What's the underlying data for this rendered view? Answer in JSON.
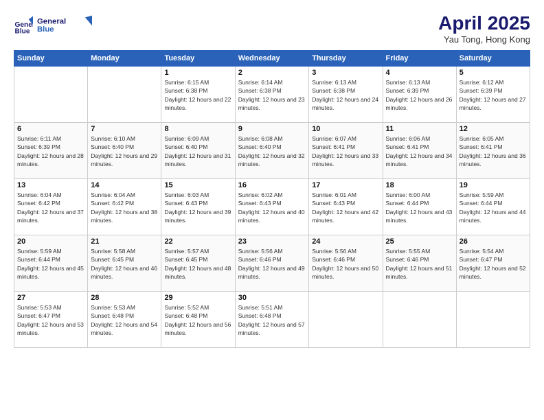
{
  "logo": {
    "line1": "General",
    "line2": "Blue"
  },
  "title": "April 2025",
  "subtitle": "Yau Tong, Hong Kong",
  "weekdays": [
    "Sunday",
    "Monday",
    "Tuesday",
    "Wednesday",
    "Thursday",
    "Friday",
    "Saturday"
  ],
  "weeks": [
    [
      {
        "day": "",
        "info": ""
      },
      {
        "day": "",
        "info": ""
      },
      {
        "day": "1",
        "info": "Sunrise: 6:15 AM\nSunset: 6:38 PM\nDaylight: 12 hours and 22 minutes."
      },
      {
        "day": "2",
        "info": "Sunrise: 6:14 AM\nSunset: 6:38 PM\nDaylight: 12 hours and 23 minutes."
      },
      {
        "day": "3",
        "info": "Sunrise: 6:13 AM\nSunset: 6:38 PM\nDaylight: 12 hours and 24 minutes."
      },
      {
        "day": "4",
        "info": "Sunrise: 6:13 AM\nSunset: 6:39 PM\nDaylight: 12 hours and 26 minutes."
      },
      {
        "day": "5",
        "info": "Sunrise: 6:12 AM\nSunset: 6:39 PM\nDaylight: 12 hours and 27 minutes."
      }
    ],
    [
      {
        "day": "6",
        "info": "Sunrise: 6:11 AM\nSunset: 6:39 PM\nDaylight: 12 hours and 28 minutes."
      },
      {
        "day": "7",
        "info": "Sunrise: 6:10 AM\nSunset: 6:40 PM\nDaylight: 12 hours and 29 minutes."
      },
      {
        "day": "8",
        "info": "Sunrise: 6:09 AM\nSunset: 6:40 PM\nDaylight: 12 hours and 31 minutes."
      },
      {
        "day": "9",
        "info": "Sunrise: 6:08 AM\nSunset: 6:40 PM\nDaylight: 12 hours and 32 minutes."
      },
      {
        "day": "10",
        "info": "Sunrise: 6:07 AM\nSunset: 6:41 PM\nDaylight: 12 hours and 33 minutes."
      },
      {
        "day": "11",
        "info": "Sunrise: 6:06 AM\nSunset: 6:41 PM\nDaylight: 12 hours and 34 minutes."
      },
      {
        "day": "12",
        "info": "Sunrise: 6:05 AM\nSunset: 6:41 PM\nDaylight: 12 hours and 36 minutes."
      }
    ],
    [
      {
        "day": "13",
        "info": "Sunrise: 6:04 AM\nSunset: 6:42 PM\nDaylight: 12 hours and 37 minutes."
      },
      {
        "day": "14",
        "info": "Sunrise: 6:04 AM\nSunset: 6:42 PM\nDaylight: 12 hours and 38 minutes."
      },
      {
        "day": "15",
        "info": "Sunrise: 6:03 AM\nSunset: 6:43 PM\nDaylight: 12 hours and 39 minutes."
      },
      {
        "day": "16",
        "info": "Sunrise: 6:02 AM\nSunset: 6:43 PM\nDaylight: 12 hours and 40 minutes."
      },
      {
        "day": "17",
        "info": "Sunrise: 6:01 AM\nSunset: 6:43 PM\nDaylight: 12 hours and 42 minutes."
      },
      {
        "day": "18",
        "info": "Sunrise: 6:00 AM\nSunset: 6:44 PM\nDaylight: 12 hours and 43 minutes."
      },
      {
        "day": "19",
        "info": "Sunrise: 5:59 AM\nSunset: 6:44 PM\nDaylight: 12 hours and 44 minutes."
      }
    ],
    [
      {
        "day": "20",
        "info": "Sunrise: 5:59 AM\nSunset: 6:44 PM\nDaylight: 12 hours and 45 minutes."
      },
      {
        "day": "21",
        "info": "Sunrise: 5:58 AM\nSunset: 6:45 PM\nDaylight: 12 hours and 46 minutes."
      },
      {
        "day": "22",
        "info": "Sunrise: 5:57 AM\nSunset: 6:45 PM\nDaylight: 12 hours and 48 minutes."
      },
      {
        "day": "23",
        "info": "Sunrise: 5:56 AM\nSunset: 6:46 PM\nDaylight: 12 hours and 49 minutes."
      },
      {
        "day": "24",
        "info": "Sunrise: 5:56 AM\nSunset: 6:46 PM\nDaylight: 12 hours and 50 minutes."
      },
      {
        "day": "25",
        "info": "Sunrise: 5:55 AM\nSunset: 6:46 PM\nDaylight: 12 hours and 51 minutes."
      },
      {
        "day": "26",
        "info": "Sunrise: 5:54 AM\nSunset: 6:47 PM\nDaylight: 12 hours and 52 minutes."
      }
    ],
    [
      {
        "day": "27",
        "info": "Sunrise: 5:53 AM\nSunset: 6:47 PM\nDaylight: 12 hours and 53 minutes."
      },
      {
        "day": "28",
        "info": "Sunrise: 5:53 AM\nSunset: 6:48 PM\nDaylight: 12 hours and 54 minutes."
      },
      {
        "day": "29",
        "info": "Sunrise: 5:52 AM\nSunset: 6:48 PM\nDaylight: 12 hours and 56 minutes."
      },
      {
        "day": "30",
        "info": "Sunrise: 5:51 AM\nSunset: 6:48 PM\nDaylight: 12 hours and 57 minutes."
      },
      {
        "day": "",
        "info": ""
      },
      {
        "day": "",
        "info": ""
      },
      {
        "day": "",
        "info": ""
      }
    ]
  ]
}
